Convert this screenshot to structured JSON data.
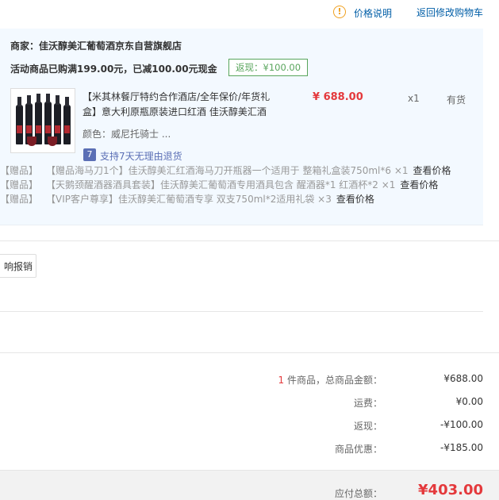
{
  "topbar": {
    "help_icon": "!",
    "help_label": "价格说明",
    "back_label": "返回修改购物车"
  },
  "shop": {
    "seller": "商家：佳沃醇美汇葡萄酒京东自营旗舰店",
    "promo": "活动商品已购满199.00元，已减100.00元现金",
    "promo_tag": "返现：¥100.00"
  },
  "product": {
    "title": "【米其林餐厅特约合作酒店/全年保价/年货礼盒】意大利原瓶原装进口红酒 佳沃醇美汇酒",
    "price": "¥ 688.00",
    "qty": "x1",
    "stock": "有货",
    "color": "颜色：威尼托骑士 ...",
    "return_icon": "7",
    "return_policy": "支持7天无理由退货"
  },
  "gifts": [
    {
      "tag": "【赠品】",
      "title": "【赠品海马刀1个】佳沃醇美汇红酒海马刀开瓶器一个适用于 整箱礼盒装750ml*6 ×1",
      "check": "查看价格"
    },
    {
      "tag": "【赠品】",
      "title": "【天鹅颈醒酒器酒具套装】佳沃醇美汇葡萄酒专用酒具包含 醒酒器*1 红酒杯*2 ×1",
      "check": "查看价格"
    },
    {
      "tag": "【赠品】",
      "title": "【VIP客户尊享】佳沃醇美汇葡萄酒专享 双支750ml*2适用礼袋 ×3",
      "check": "查看价格"
    }
  ],
  "report_button": "响报销",
  "summary": {
    "count": "1",
    "items_label": " 件商品，总商品金额：",
    "items_value": "¥688.00",
    "shipping_label": "运费：",
    "shipping_value": "¥0.00",
    "cashback_label": "返现：",
    "cashback_value": "-¥100.00",
    "discount_label": "商品优惠：",
    "discount_value": "-¥185.00",
    "total_label": "应付总额：",
    "total_value": "¥403.00"
  },
  "colors": {
    "accent_red": "#e4393c",
    "link_blue": "#005ea7",
    "promo_green": "#58a55c",
    "panel_bg": "#f3f9ff"
  }
}
